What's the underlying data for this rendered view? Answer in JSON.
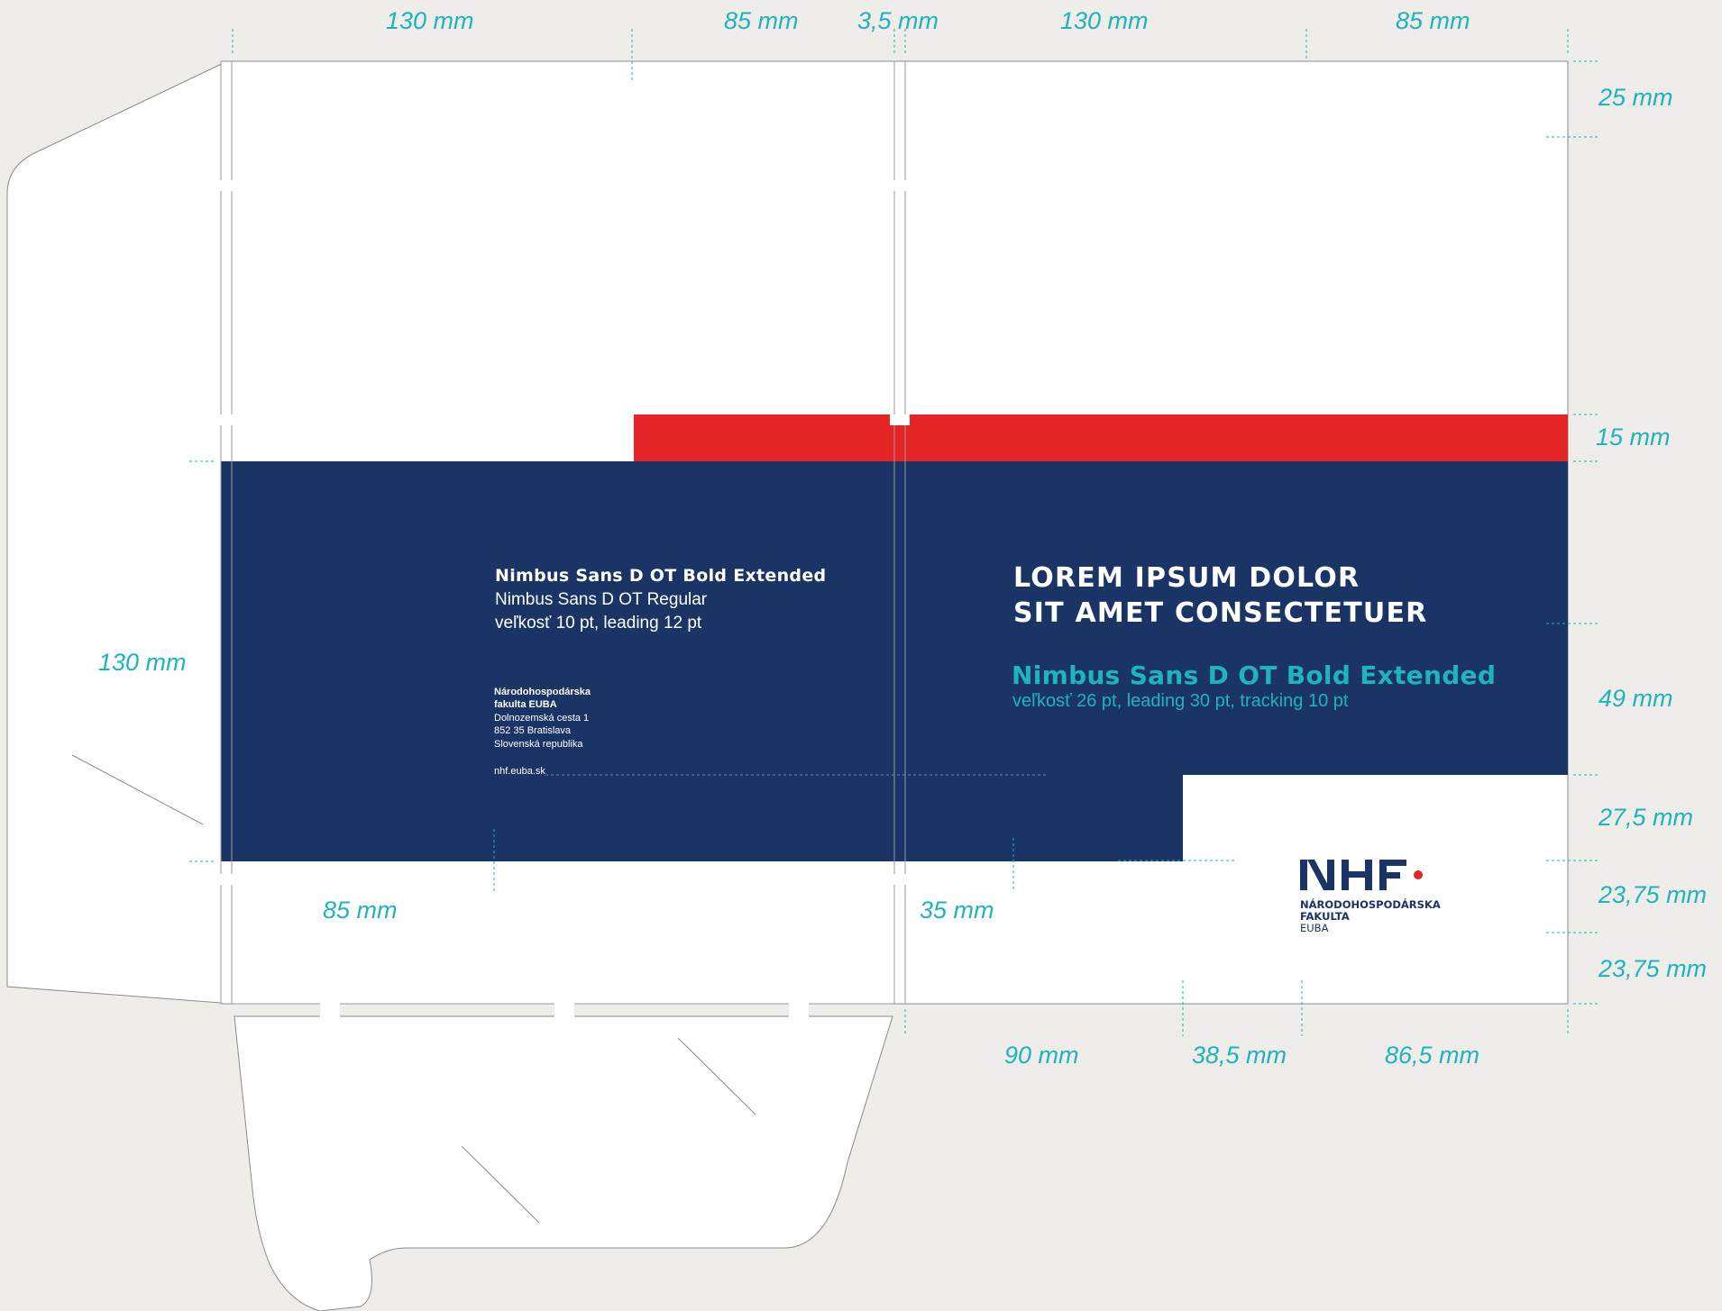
{
  "colors": {
    "navy": "#1a3466",
    "red": "#e42425",
    "teal": "#1fb3bd",
    "background": "#eeede9",
    "paper": "#ffffff",
    "logo_dot": "#e42425"
  },
  "dimensions": {
    "top": [
      "130 mm",
      "85 mm",
      "3,5 mm",
      "130 mm",
      "85 mm"
    ],
    "right": [
      "25 mm",
      "15 mm",
      "49 mm",
      "27,5 mm",
      "23,75 mm",
      "23,75 mm"
    ],
    "left": "130 mm",
    "inner_bottom": [
      "85 mm",
      "35 mm"
    ],
    "bottom": [
      "90 mm",
      "38,5 mm",
      "86,5 mm"
    ]
  },
  "spec_left": {
    "title": "Nimbus Sans D OT Bold Extended",
    "line2": "Nimbus Sans D OT Regular",
    "line3": "veľkosť 10 pt, leading 12 pt"
  },
  "address": {
    "name_line1": "Národohospodárska",
    "name_line2": "fakulta EUBA",
    "street": "Dolnozemská cesta 1",
    "city": "852 35 Bratislava",
    "country": "Slovenská republika",
    "web": "nhf.euba.sk"
  },
  "headline": {
    "line1": "LOREM IPSUM DOLOR",
    "line2": "SIT AMET CONSECTETUER"
  },
  "spec_right": {
    "title": "Nimbus Sans D OT Bold Extended",
    "subtitle": "veľkosť 26 pt, leading 30 pt, tracking 10 pt"
  },
  "logo": {
    "mark": "NHF",
    "line1": "NÁRODOHOSPODÁRSKA",
    "line2": "FAKULTA",
    "line3": "EUBA"
  }
}
